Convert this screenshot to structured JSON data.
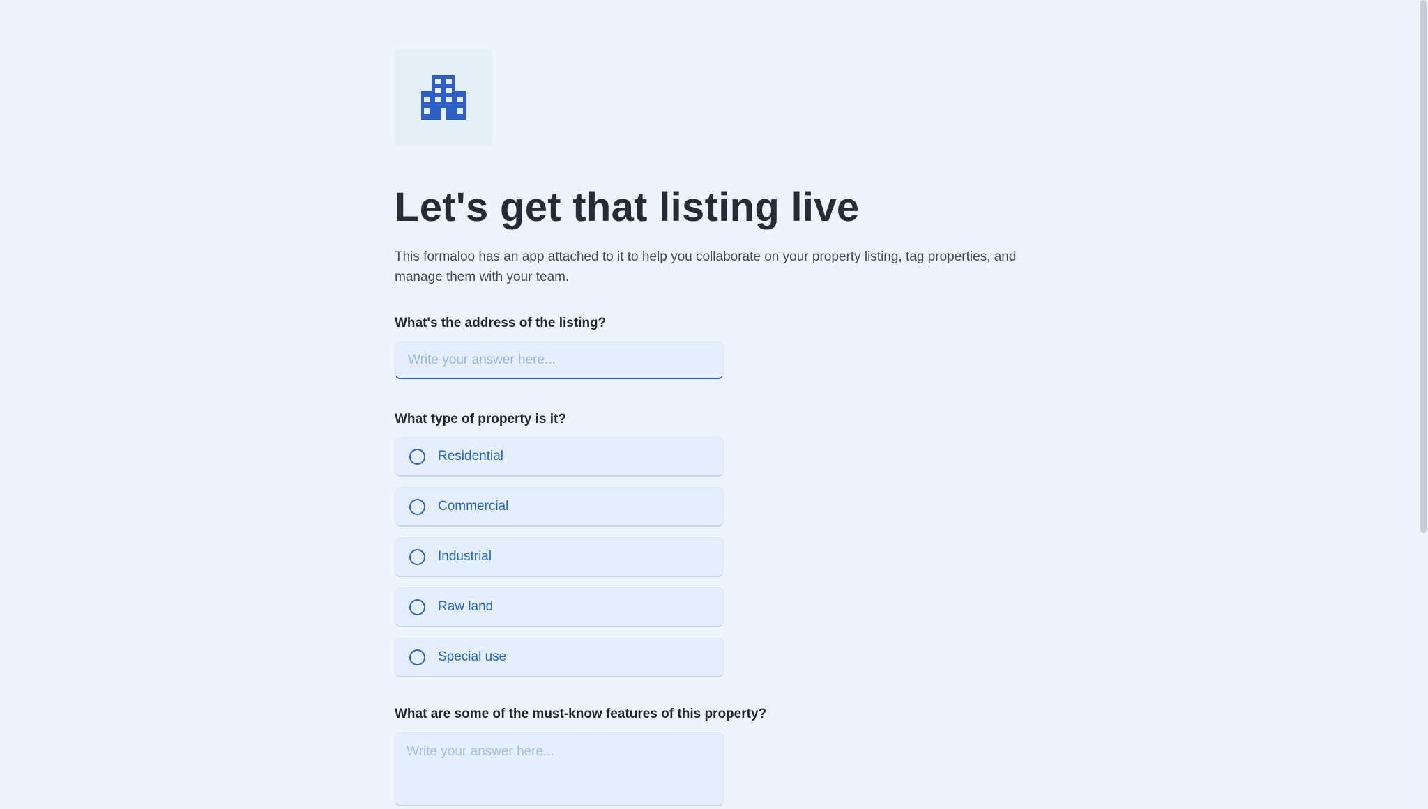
{
  "logo": {
    "icon": "building-icon",
    "color": "#2e5fc5"
  },
  "form": {
    "title": "Let's get that listing live",
    "description": "This formaloo has an app attached to it to help you collaborate on your property listing, tag properties, and manage them with your team."
  },
  "address": {
    "label": "What's the address of the listing?",
    "placeholder": "Write your answer here...",
    "value": ""
  },
  "property_type": {
    "label": "What type of property is it?",
    "options": [
      "Residential",
      "Commercial",
      "Industrial",
      "Raw land",
      "Special use"
    ]
  },
  "features": {
    "label": "What are some of the must-know features of this property?",
    "placeholder": "Write your answer here...",
    "value": ""
  },
  "colors": {
    "background": "#edf4fe",
    "accent": "#2e5fc5",
    "option_text": "#2467c6",
    "title": "#252c38"
  }
}
